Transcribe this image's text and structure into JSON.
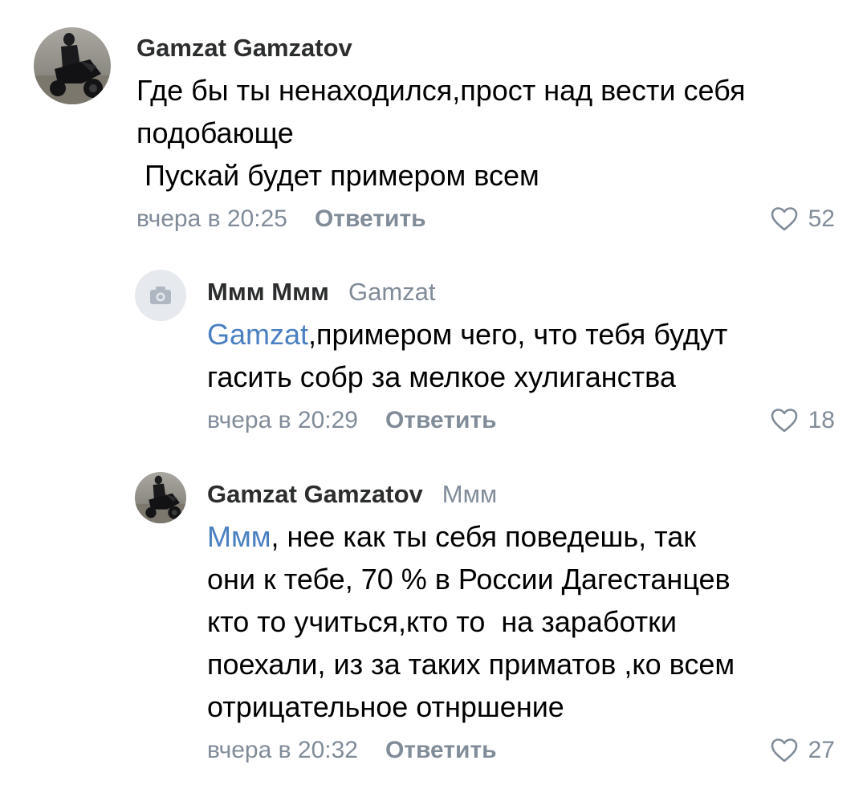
{
  "comments": [
    {
      "author": "Gamzat Gamzatov",
      "reply_to": "",
      "text_lines": [
        "Где бы ты ненаходился,прост над вести себя",
        "подобающе",
        " Пускай будет примером всем"
      ],
      "time": "вчера в 20:25",
      "reply_label": "Ответить",
      "likes": "52"
    },
    {
      "author": "Ммм Ммм",
      "reply_to": "Gamzat",
      "mention": "Gamzat",
      "text_first_rest": ",примером чего, что тебя будут",
      "text_lines_rest": [
        "гасить собр за мелкое хулиганства"
      ],
      "time": "вчера в 20:29",
      "reply_label": "Ответить",
      "likes": "18"
    },
    {
      "author": "Gamzat Gamzatov",
      "reply_to": "Ммм",
      "mention": "Ммм",
      "text_first_rest": ", нее как ты себя поведешь, так",
      "text_lines_rest": [
        "они к тебе, 70 % в России Дагестанцев",
        "кто то учиться,кто то  на заработки",
        "поехали, из за таких приматов ,ко всем",
        "отрицательное отнршение"
      ],
      "time": "вчера в 20:32",
      "reply_label": "Ответить",
      "likes": "27"
    }
  ],
  "colors": {
    "secondary": "#818c99",
    "mention": "#4a7fc1",
    "author": "#2c2d2e"
  },
  "icons": {
    "like": "heart-outline-icon",
    "placeholder_avatar": "camera-icon"
  }
}
